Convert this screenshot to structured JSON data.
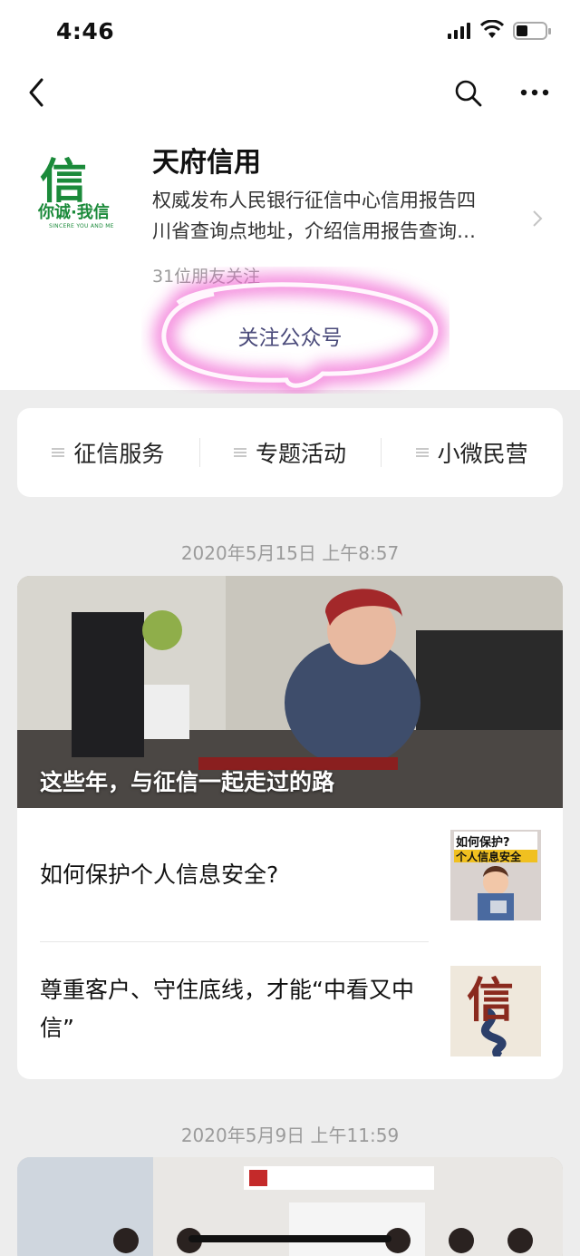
{
  "status_bar": {
    "time": "4:46"
  },
  "nav": {
    "back_icon": "chevron-left-icon",
    "search_icon": "search-icon",
    "more_icon": "more-dots-icon"
  },
  "profile": {
    "logo_glyph": "信",
    "logo_text": "你诚·我信",
    "logo_sub": "SINCERE YOU AND ME",
    "name": "天府信用",
    "desc_line1": "权威发布人民银行征信中心信用报告四",
    "desc_line2": "川省查询点地址，介绍信用报告查询…",
    "followers": "31位朋友关注",
    "follow_label": "关注公众号",
    "highlight_color": "#e040c0"
  },
  "menu": {
    "items": [
      {
        "label": "征信服务"
      },
      {
        "label": "专题活动"
      },
      {
        "label": "小微民营"
      }
    ]
  },
  "feed": [
    {
      "date": "2020年5月15日 上午8:57",
      "hero_caption": "这些年，与征信一起走过的路",
      "sub_articles": [
        {
          "title": "如何保护个人信息安全?",
          "thumb_text1": "如何保护?",
          "thumb_text2": "个人信息安全"
        },
        {
          "title": "尊重客户、守住底线，才能“中看又中信”",
          "thumb_glyph": "信"
        }
      ]
    },
    {
      "date": "2020年5月9日 上午11:59"
    }
  ]
}
